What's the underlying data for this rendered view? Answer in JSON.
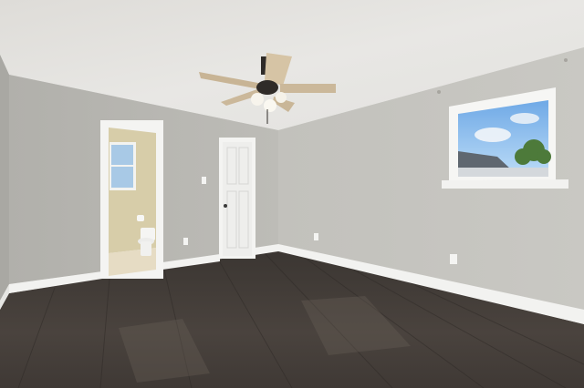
{
  "scene": {
    "subject": "empty bedroom",
    "objects": [
      "ceiling-fan",
      "window",
      "bathroom-doorway",
      "closed-door",
      "toilet",
      "hardwood-floor",
      "baseboards",
      "outlets",
      "light-switch"
    ]
  },
  "colors": {
    "ceiling": "#e4e3e0",
    "left_wall": "#b8b7b2",
    "back_wall": "#c3c2bd",
    "right_wall": "#c7c6c1",
    "trim": "#f3f3f1",
    "floor_dark": "#3a3531",
    "floor_light": "#5a524c",
    "bath_wall": "#d9cfb0",
    "sky": "#9cc8f0",
    "fan_blade": "#cbb89a",
    "fan_body": "#2f2b28"
  }
}
